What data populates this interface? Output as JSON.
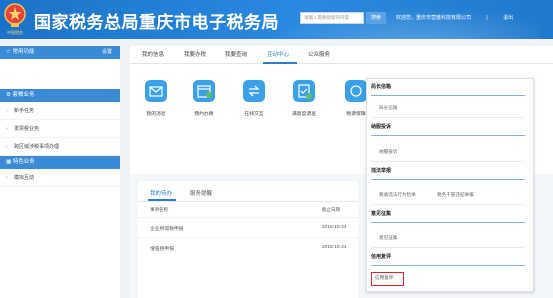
{
  "header": {
    "emblem_text": "中国税务",
    "title": "国家税务总局重庆市电子税务局",
    "search_placeholder": "请输入需要搜索的内容",
    "search_button": "搜索",
    "user": "欢迎您，重庆市营盛科技有限公司",
    "divider": "|",
    "logout": "退出"
  },
  "sidebar": {
    "common_head": "常用功能",
    "common_right": "设置",
    "my_biz_head": "套餐业务",
    "items1": [
      "新手任务",
      "发票税业务",
      "跨区域涉税事项办理"
    ],
    "special_head": "特色业务",
    "items2": [
      "模拟互动"
    ]
  },
  "tabs": [
    "我的信息",
    "我要办税",
    "我要查询",
    "互动中心",
    "公众服务"
  ],
  "icons": [
    {
      "label": "我的消息",
      "color": "#3aa1e8"
    },
    {
      "label": "预约办税",
      "color": "#3aa1e8"
    },
    {
      "label": "在线交互",
      "color": "#3aa1e8"
    },
    {
      "label": "满意度调查",
      "color": "#3aa1e8"
    },
    {
      "label": "税源保障",
      "color": "#3aa1e8"
    }
  ],
  "todo": {
    "tabs": [
      "我的待办",
      "服务提醒"
    ],
    "col_name": "事项名称",
    "col_deadline": "截止日期",
    "rows": [
      {
        "name": "企业所得税申报",
        "date": "2018-10-24"
      },
      {
        "name": "增值税申报",
        "date": "2018-10-24"
      }
    ]
  },
  "menu": {
    "sections": [
      {
        "head": "局长信箱",
        "items": [
          "局长信箱"
        ]
      },
      {
        "head": "纳服投诉",
        "items": [
          "纳服投诉"
        ]
      },
      {
        "head": "违法举报",
        "items": [
          "税收违法行为检举",
          "税务干部违纪举报"
        ]
      },
      {
        "head": "意见征集",
        "items": [
          "意见征集"
        ]
      },
      {
        "head": "信用复评",
        "items": [
          "信用复评"
        ]
      }
    ]
  },
  "colors": {
    "header_blue": "#1b73c9",
    "accent": "#2a7fd4",
    "highlight": "#e0202a"
  }
}
